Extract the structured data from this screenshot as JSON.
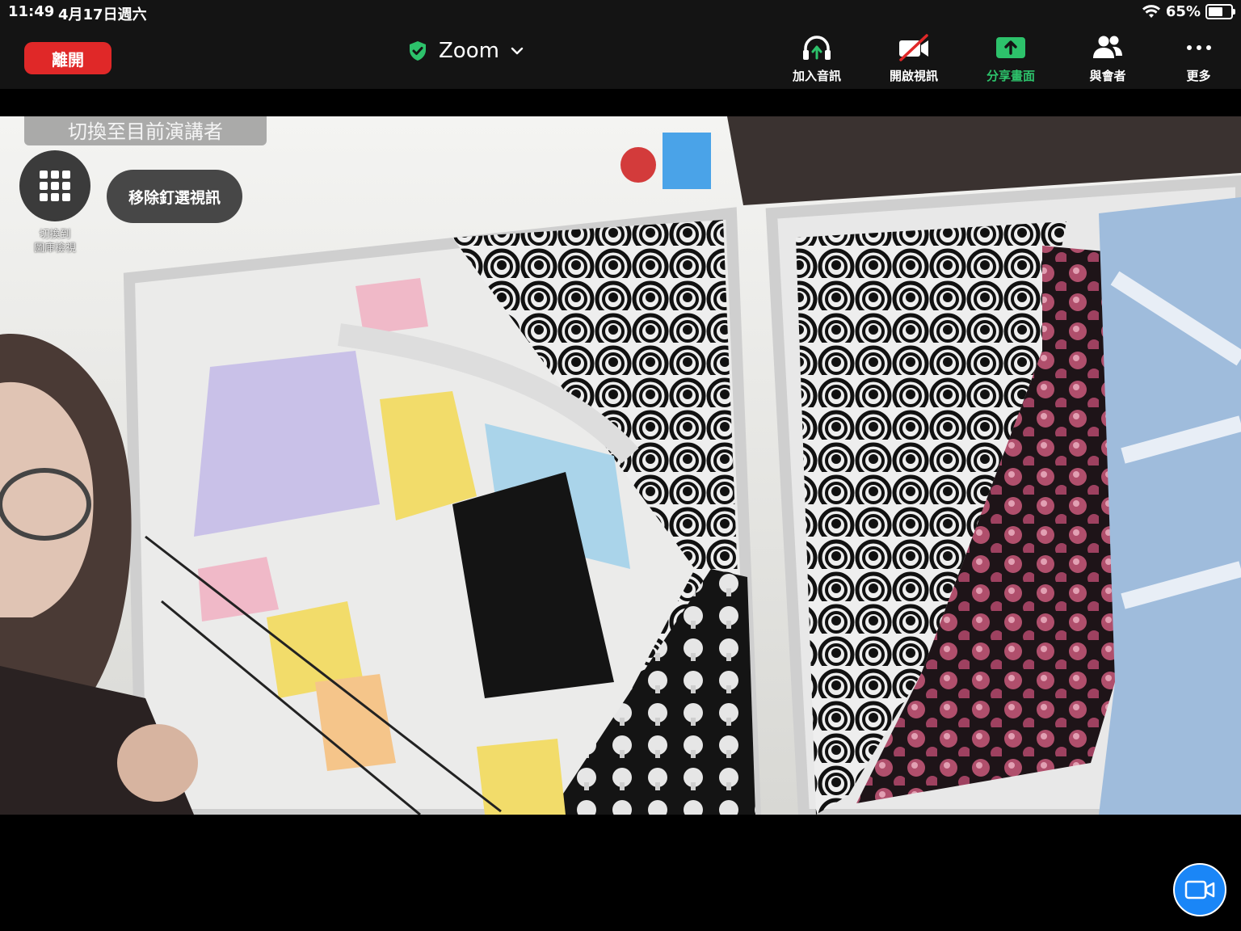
{
  "status_bar": {
    "time": "11:49",
    "date": "4月17日週六",
    "battery_text": "65%",
    "battery_level": 0.65
  },
  "top_bar": {
    "leave_label": "離開",
    "meeting_name": "Zoom",
    "tools": [
      {
        "label": "加入音訊",
        "icon": "headphone-icon"
      },
      {
        "label": "開啟視訊",
        "icon": "video-off-icon"
      },
      {
        "label": "分享畫面",
        "icon": "share-screen-icon"
      },
      {
        "label": "與會者",
        "icon": "participants-icon"
      },
      {
        "label": "更多",
        "icon": "more-icon"
      }
    ]
  },
  "video": {
    "switch_speaker_label": "切換至目前演講者",
    "gallery_caption_line1": "切換到",
    "gallery_caption_line2": "圖庫檢視",
    "unpin_label": "移除釘選視訊"
  },
  "colors": {
    "leave_red": "#e02828",
    "share_green": "#2dc26b",
    "fab_blue": "#1a86f7",
    "bar_bg": "#141414"
  }
}
